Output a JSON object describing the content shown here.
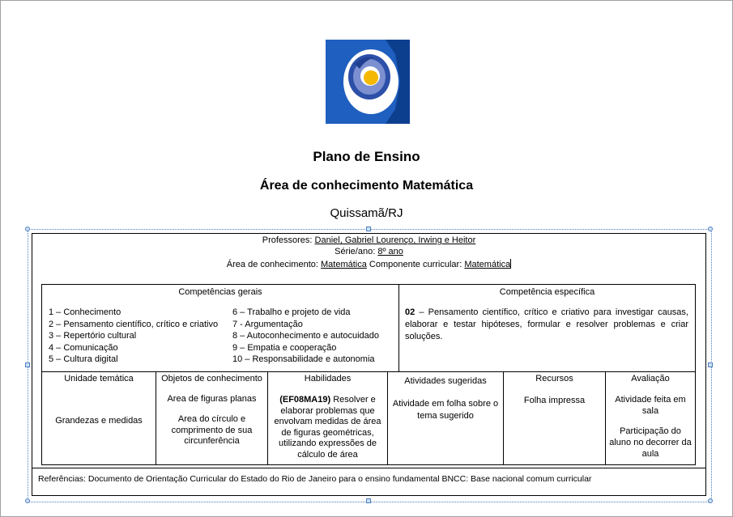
{
  "header": {
    "title": "Plano de Ensino",
    "subtitle": "Área de conhecimento Matemática",
    "location": "Quissamã/RJ"
  },
  "info": {
    "professores_label": "Professores:",
    "professores_value": "Daniel, Gabriel Lourenço, Irwing e Heitor",
    "serie_label": "Série/ano:",
    "serie_value": "8º ano",
    "area_label": "Área de conhecimento:",
    "area_value": "Matemática",
    "componente_label": "Componente curricular:",
    "componente_value": "Matemática"
  },
  "competencias": {
    "gerais_header": "Competências gerais",
    "especifica_header": "Competência específica",
    "gerais_col1": [
      "1 – Conhecimento",
      "2 – Pensamento científico, crítico e criativo",
      "3 – Repertório cultural",
      "4 – Comunicação",
      "5 – Cultura digital"
    ],
    "gerais_col2": [
      "6 – Trabalho e projeto de vida",
      "7 - Argumentação",
      "8 – Autoconhecimento e autocuidado",
      "9 – Empatia e cooperação",
      "10 – Responsabilidade e autonomia"
    ],
    "especifica_code": "02",
    "especifica_text": "– Pensamento científico, crítico e criativo para investigar causas, elaborar e testar hipóteses, formular e resolver problemas e criar soluções."
  },
  "table": {
    "headers": [
      "Unidade temática",
      "Objetos de conhecimento",
      "Habilidades",
      "Atividades sugeridas",
      "Recursos",
      "Avaliação"
    ],
    "unidade": "Grandezas e medidas",
    "objetos_1": "Area de figuras planas",
    "objetos_2": "Area do círculo e comprimento de sua circunferência",
    "habilidade_code": "(EF08MA19)",
    "habilidade_text": "Resolver e elaborar problemas que envolvam medidas de área de figuras geométricas, utilizando expressões de cálculo de área",
    "atividades": "Atividade em folha sobre o tema sugerido",
    "recursos": "Folha impressa",
    "avaliacao_1": "Atividade feita em sala",
    "avaliacao_2": "Participação do aluno no decorrer da aula"
  },
  "referencias": "Referências: Documento de Orientação Curricular do Estado do Rio de Janeiro para o ensino fundamental BNCC: Base nacional comum curricular",
  "logo": {
    "icon": "school-logo-icon",
    "colors": [
      "#1f5fbf",
      "#0d3f8f",
      "#6f82c8",
      "#f5b800"
    ]
  }
}
